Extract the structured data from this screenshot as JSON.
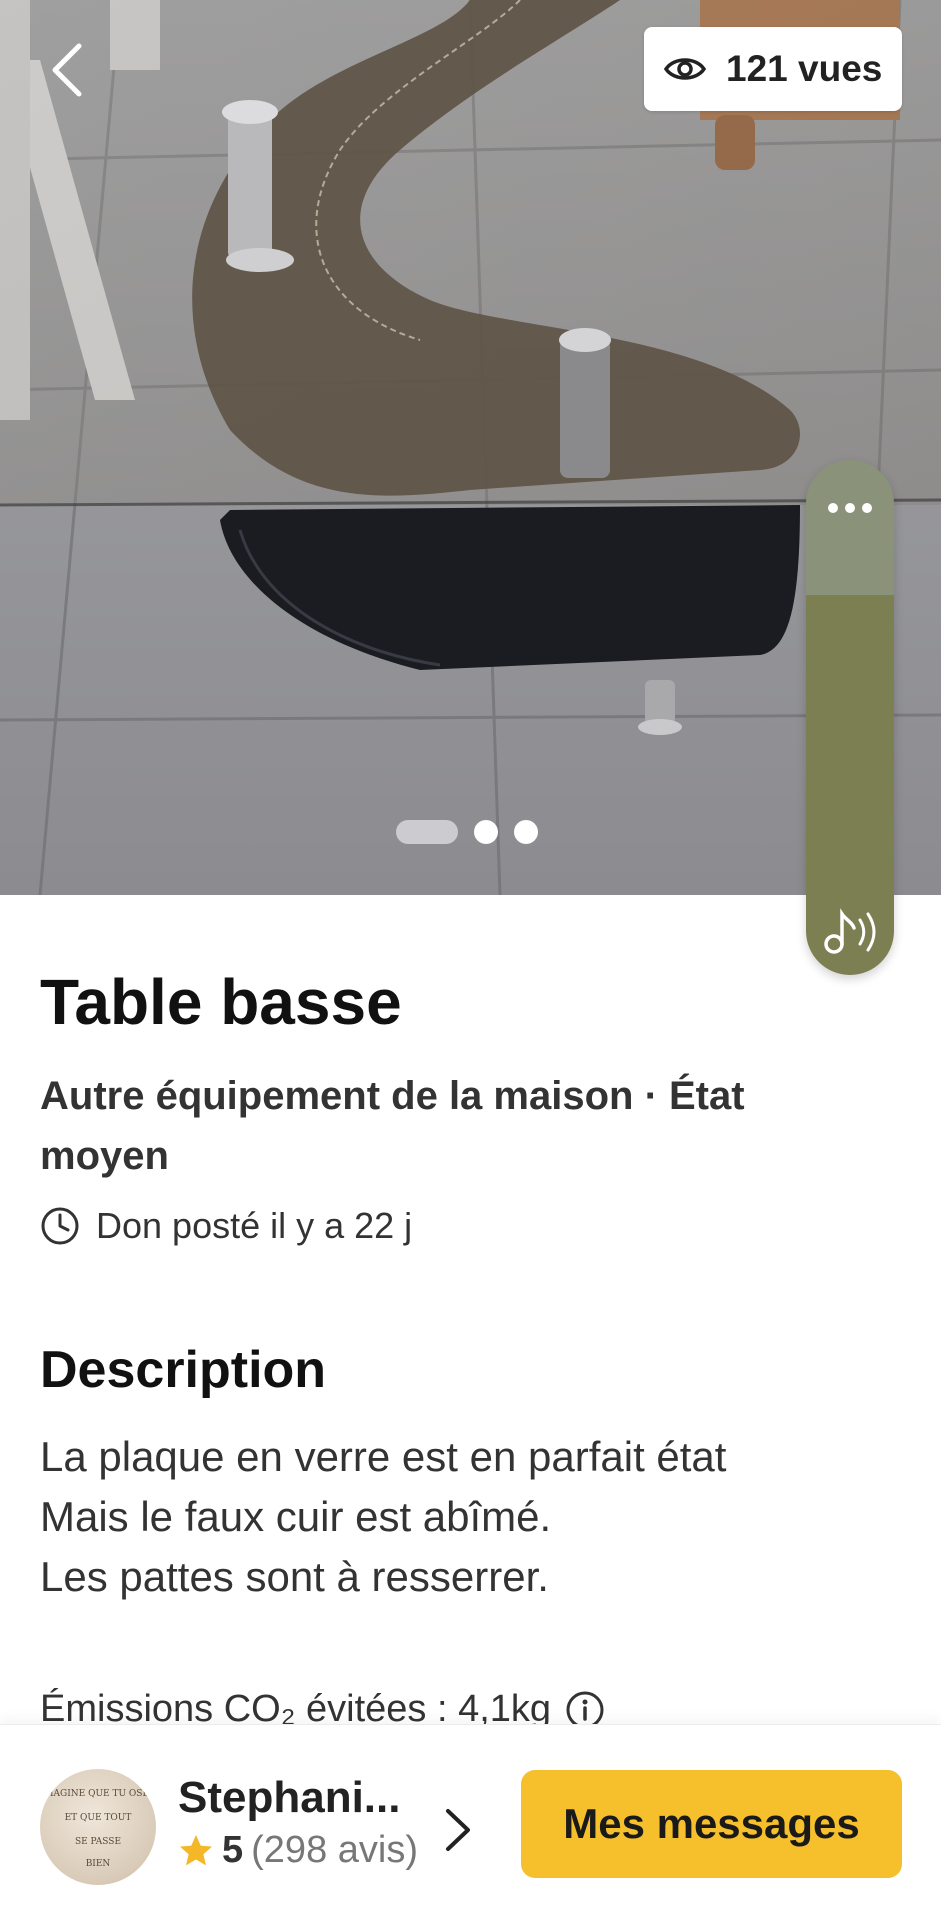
{
  "hero": {
    "views_label": "121 vues",
    "icons": {
      "back": "chevron-left-icon",
      "views": "eye-icon"
    },
    "pager": {
      "total": 3,
      "active_index": 0
    }
  },
  "rail": {
    "icons": {
      "more": "more-dots-icon",
      "audio": "music-note-sound-icon"
    },
    "colors": {
      "top": "#8a937a",
      "bottom": "#7b7f52"
    }
  },
  "listing": {
    "title": "Table basse",
    "subtitle": "Autre équipement de la maison · État moyen",
    "posted": "Don posté il y a 22 j",
    "description_heading": "Description",
    "description_lines": [
      "La plaque en verre est en parfait état",
      "Mais le faux cuir est abîmé.",
      "Les pattes sont à resserrer."
    ],
    "emissions": "Émissions CO₂ évitées : 4,1kg"
  },
  "seller": {
    "name": "Stephani...",
    "avatar_text": [
      "IMAGINE QUE TU OSES",
      "ET QUE TOUT",
      "SE PASSE",
      "BIEN"
    ],
    "rating_score": "5",
    "rating_count": "(298 avis)"
  },
  "actions": {
    "messages_label": "Mes messages"
  },
  "colors": {
    "accent": "#f6c02c",
    "star": "#f4b728",
    "text_dark": "#111111"
  }
}
